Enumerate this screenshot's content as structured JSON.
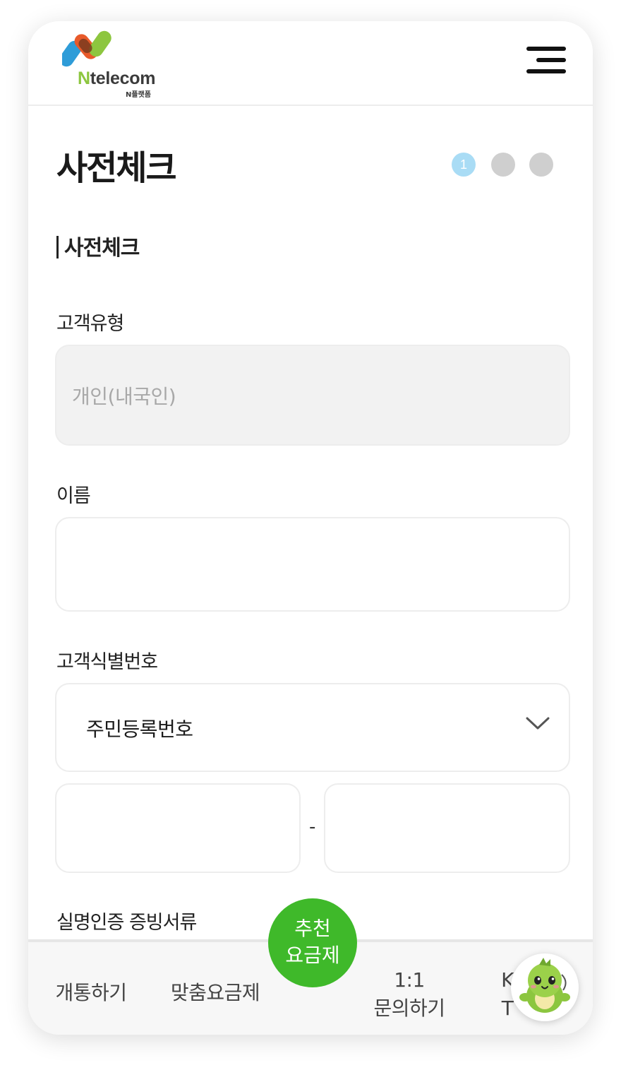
{
  "header": {
    "logo_text": "telecom",
    "logo_letter": "N",
    "logo_subtitle": "N플랫폼",
    "menu_icon": "hamburger-menu-icon"
  },
  "page": {
    "title": "사전체크",
    "steps": [
      {
        "label": "1",
        "active": true
      },
      {
        "label": "",
        "active": false
      },
      {
        "label": "",
        "active": false
      }
    ],
    "section_title": "사전체크"
  },
  "form": {
    "customer_type": {
      "label": "고객유형",
      "value": "개인(내국인)"
    },
    "name": {
      "label": "이름",
      "value": ""
    },
    "id_type": {
      "label": "고객식별번호",
      "selected": "주민등록번호"
    },
    "id_number": {
      "separator": "-",
      "part1": "",
      "part2": ""
    },
    "proof_docs": {
      "label": "실명인증 증빙서류"
    }
  },
  "bottom_nav": {
    "items": [
      "개통하기",
      "맞춤요금제",
      "1:1",
      "문의하기",
      "K",
      "T"
    ],
    "fab_line1": "추천",
    "fab_line2": "요금제"
  },
  "colors": {
    "accent_green": "#3fb92a",
    "step_active": "#a9dcf5",
    "step_inactive": "#cfcfcf"
  }
}
